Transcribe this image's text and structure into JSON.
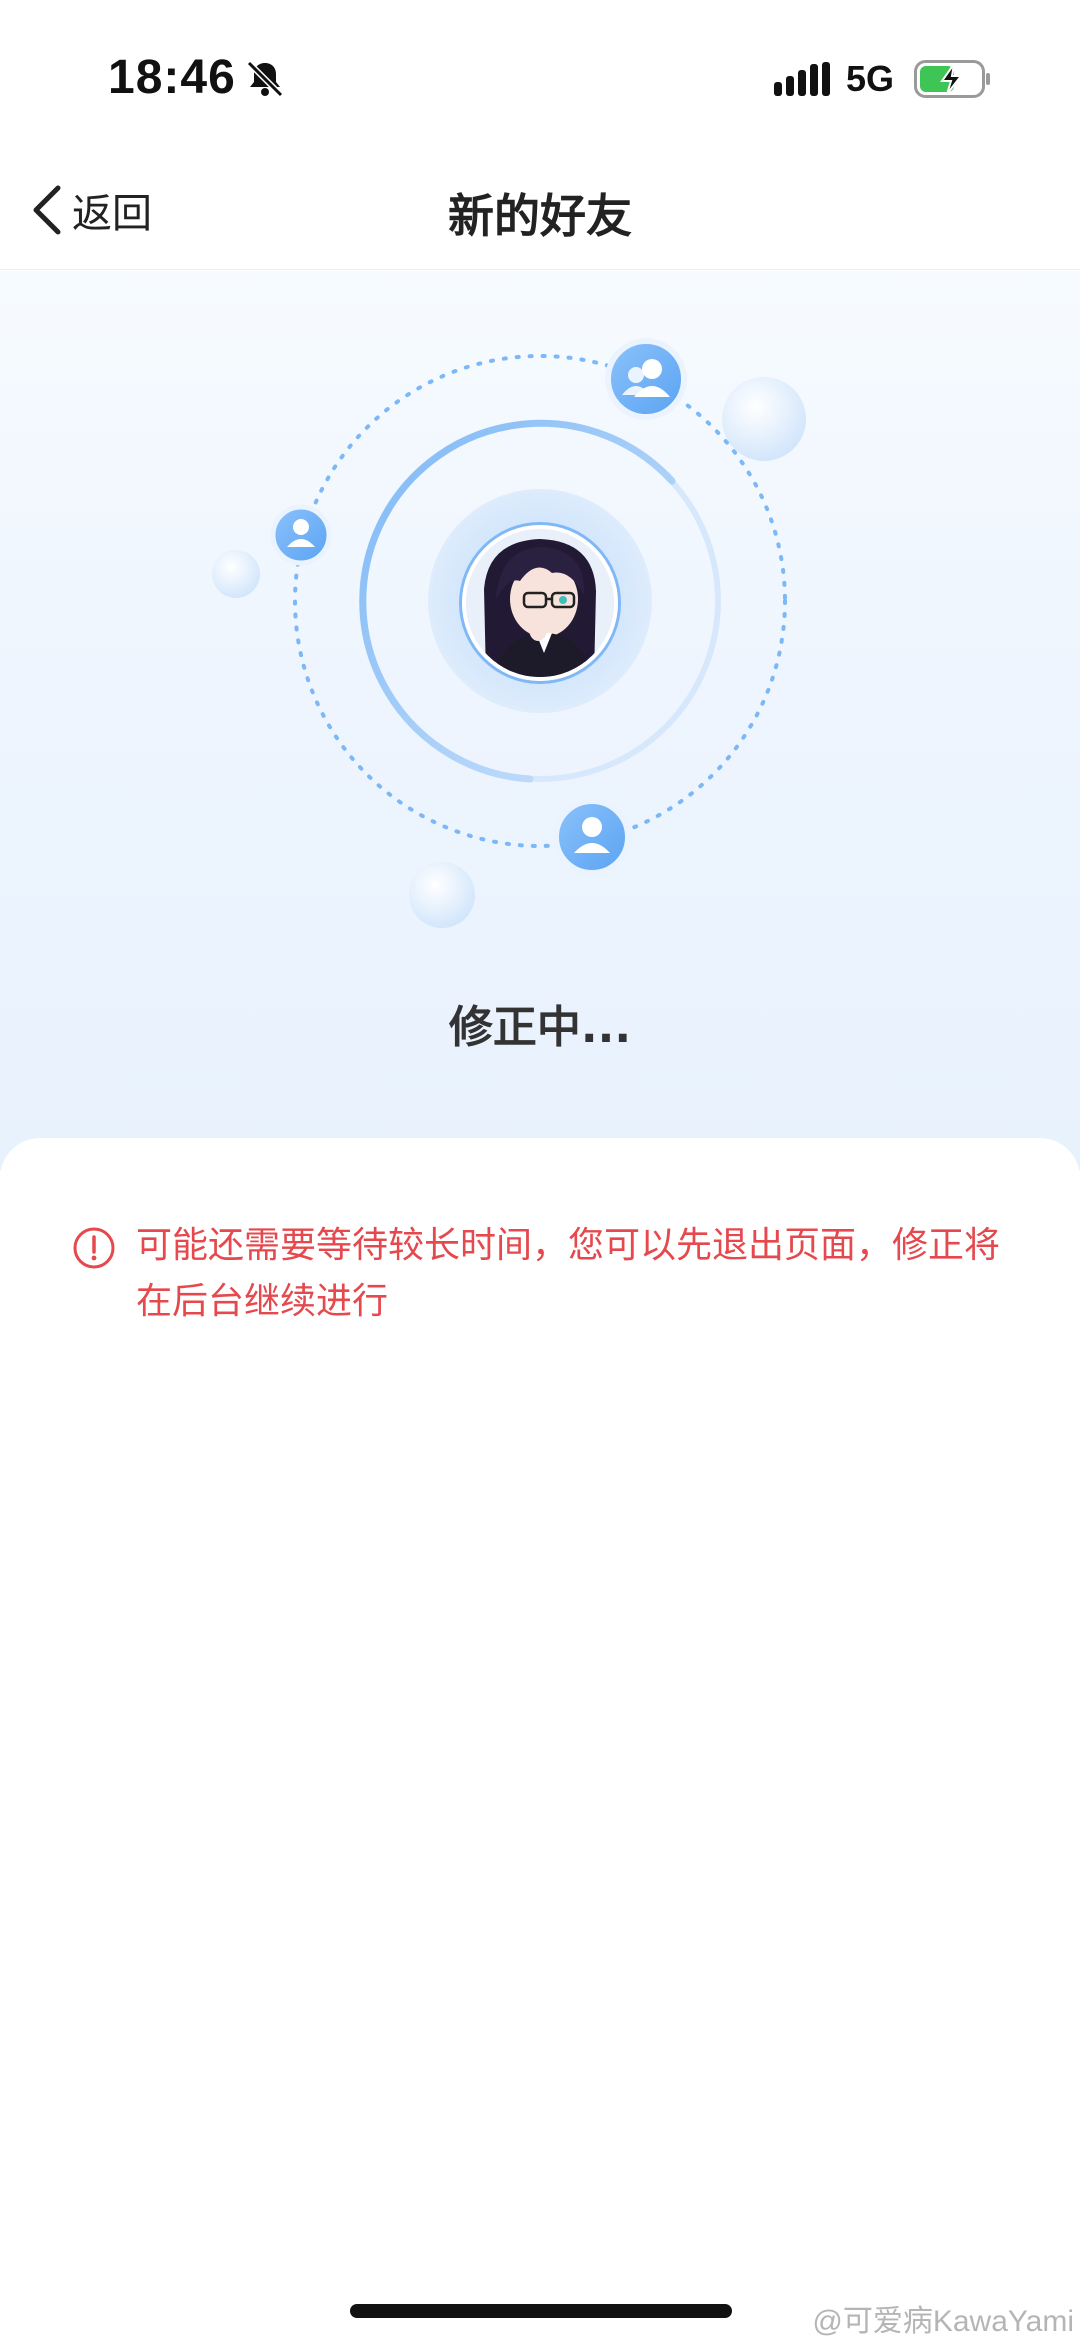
{
  "status_bar": {
    "time": "18:46",
    "network": "5G",
    "icons": [
      "bell-muted-icon",
      "signal-icon",
      "battery-charging-icon"
    ],
    "battery_color": "#3fc456"
  },
  "nav": {
    "back_label": "返回",
    "title": "新的好友"
  },
  "hero": {
    "status_text": "修正中...",
    "orbit_icons": [
      "group-icon",
      "user-icon",
      "user-icon"
    ],
    "accent_color": "#6aaef7"
  },
  "notice": {
    "icon": "exclamation-circle-icon",
    "text": "可能还需要等待较长时间，您可以先退出页面，修正将在后台继续进行",
    "color": "#e5484d"
  },
  "watermark": "@可爱病KawaYami"
}
